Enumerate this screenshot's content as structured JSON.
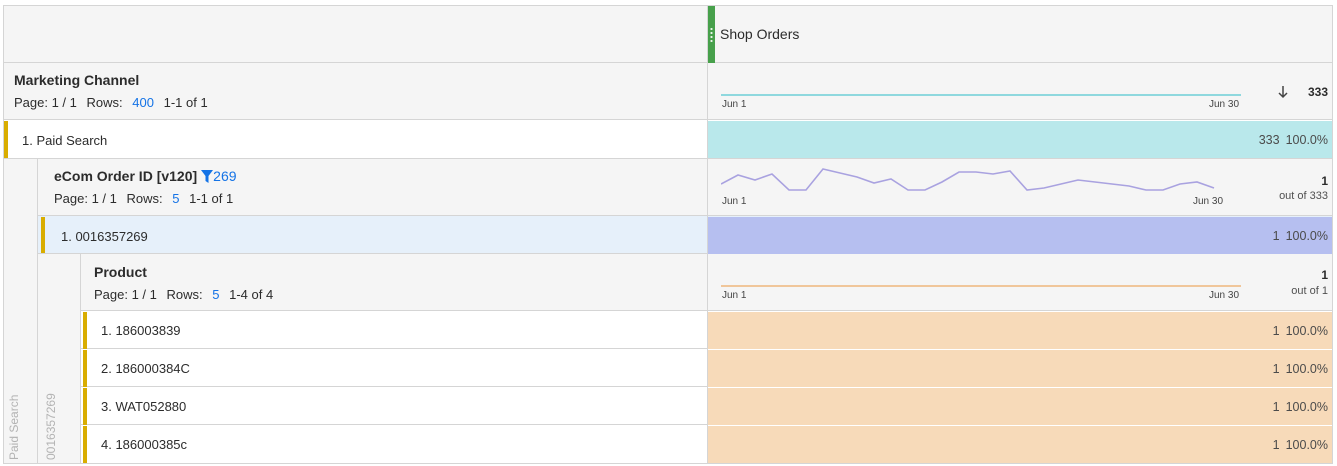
{
  "metric": {
    "title": "Shop Orders",
    "total": "333"
  },
  "dim1": {
    "title": "Marketing Channel",
    "page_label": "Page: 1 / 1",
    "rows_label": "Rows:",
    "rows_value": "400",
    "range": "1-1 of 1",
    "spark_start": "Jun 1",
    "spark_end": "Jun 30",
    "sort_icon": "arrow-down-icon",
    "row": {
      "label": "1. Paid Search",
      "value": "333",
      "percent": "100.0%",
      "color": "#b9e8eb"
    }
  },
  "dim2": {
    "title": "eCom Order ID [v120]",
    "filter_value": "269",
    "page_label": "Page: 1 / 1",
    "rows_label": "Rows:",
    "rows_value": "5",
    "range": "1-1 of 1",
    "spark_start": "Jun 1",
    "spark_end": "Jun 30",
    "total_value": "1",
    "total_sub": "out of 333",
    "row": {
      "label": "1. 0016357269",
      "value": "1",
      "percent": "100.0%",
      "color": "#b6bff0"
    }
  },
  "dim3": {
    "title": "Product",
    "page_label": "Page: 1 / 1",
    "rows_label": "Rows:",
    "rows_value": "5",
    "range": "1-4 of 4",
    "spark_start": "Jun 1",
    "spark_end": "Jun 30",
    "total_value": "1",
    "total_sub": "out of 1",
    "rows": [
      {
        "label": "1. 186003839",
        "value": "1",
        "percent": "100.0%"
      },
      {
        "label": "2. 186000384C",
        "value": "1",
        "percent": "100.0%"
      },
      {
        "label": "3. WAT052880",
        "value": "1",
        "percent": "100.0%"
      },
      {
        "label": "4. 186000385c",
        "value": "1",
        "percent": "100.0%"
      }
    ],
    "color": "#f7dab9"
  },
  "rails": {
    "outer": "Paid Search",
    "inner": "0016357269"
  },
  "colors": {
    "accent_bar": "#d9ad00",
    "metric_grip": "#47a04b",
    "link": "#1473e6"
  }
}
